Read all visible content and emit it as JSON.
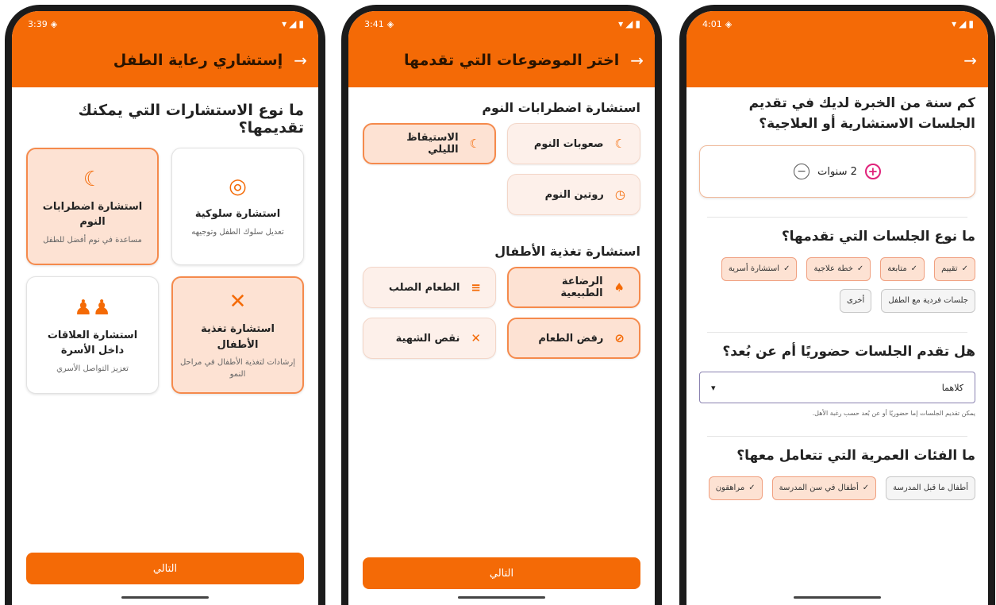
{
  "screen1": {
    "time": "3:39",
    "title": "إستشاري رعاية الطفل",
    "question": "ما نوع الاستشارات التي يمكنك تقديمها؟",
    "cards": [
      {
        "title": "استشارة سلوكية",
        "subtitle": "تعديل سلوك الطفل وتوجيهه",
        "icon": "behavior-icon",
        "selected": false
      },
      {
        "title": "استشارة اضطرابات النوم",
        "subtitle": "مساعدة في نوم أفضل للطفل",
        "icon": "moon-icon",
        "selected": true
      },
      {
        "title": "استشارة تغذية الأطفال",
        "subtitle": "إرشادات لتغذية الأطفال في مراحل النمو",
        "icon": "utensils-icon",
        "selected": true
      },
      {
        "title": "استشارة العلاقات داخل الأسرة",
        "subtitle": "تعزيز التواصل الأسري",
        "icon": "family-icon",
        "selected": false
      }
    ],
    "next": "التالي"
  },
  "screen2": {
    "time": "3:41",
    "title": "اختر الموضوعات التي تقدمها",
    "section1": "استشارة اضطرابات النوم",
    "sleep": [
      {
        "label": "صعوبات النوم",
        "icon": "moon-icon",
        "selected": false
      },
      {
        "label": "الاستيقاظ الليلي",
        "icon": "moon-icon",
        "selected": true
      },
      {
        "label": "روتين النوم",
        "icon": "clock-icon",
        "selected": false
      }
    ],
    "section2": "استشارة تغذية الأطفال",
    "nutrition": [
      {
        "label": "الرضاعة الطبيعية",
        "icon": "breastfeeding-icon",
        "selected": true
      },
      {
        "label": "الطعام الصلب",
        "icon": "solid-food-icon",
        "selected": false
      },
      {
        "label": "رفض الطعام",
        "icon": "block-icon",
        "selected": true
      },
      {
        "label": "نقص الشهية",
        "icon": "utensils-icon",
        "selected": false
      }
    ],
    "next": "التالي"
  },
  "screen3": {
    "time": "4:01",
    "q_experience": "كم سنة من الخبرة لديك في تقديم الجلسات الاستشارية أو العلاجية؟",
    "years_value": "2 سنوات",
    "q_session_type": "ما نوع الجلسات التي تقدمها؟",
    "session_types": [
      {
        "label": "تقييم",
        "on": true
      },
      {
        "label": "متابعة",
        "on": true
      },
      {
        "label": "خطة علاجية",
        "on": true
      },
      {
        "label": "استشارة أسرية",
        "on": true
      },
      {
        "label": "جلسات فردية مع الطفل",
        "on": false
      },
      {
        "label": "أخرى",
        "on": false
      }
    ],
    "q_mode": "هل تقدم الجلسات حضوريًا أم عن بُعد؟",
    "mode_value": "كلاهما",
    "mode_help": "يمكن تقديم الجلسات إما حضوريًا أو عن بُعد حسب رغبة الأهل.",
    "q_ages": "ما الفئات العمرية التي تتعامل معها؟",
    "ages": [
      {
        "label": "أطفال ما قبل المدرسة",
        "on": false
      },
      {
        "label": "أطفال في سن المدرسة",
        "on": true
      },
      {
        "label": "مراهقون",
        "on": true
      }
    ]
  },
  "colors": {
    "accent": "#f46a06",
    "selected_bg": "#fde2d3",
    "selected_border": "#f58a4c"
  }
}
